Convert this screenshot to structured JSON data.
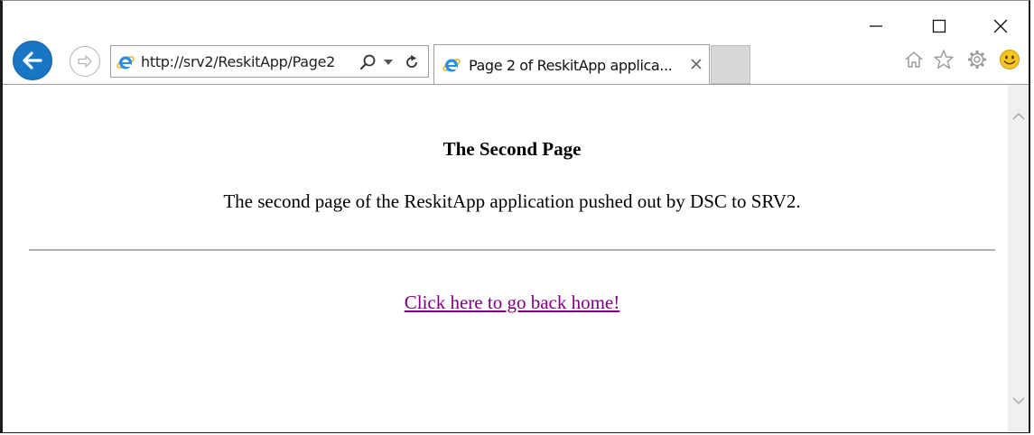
{
  "window": {
    "controls": {
      "minimize_icon": "minimize-icon",
      "maximize_icon": "maximize-icon",
      "close_icon": "close-icon"
    }
  },
  "toolbar": {
    "back_icon": "back-arrow-icon",
    "forward_icon": "forward-arrow-icon",
    "address": {
      "url": "http://srv2/ReskitApp/Page2",
      "icons": [
        "ie-logo-icon",
        "search-icon",
        "dropdown-icon",
        "refresh-icon"
      ]
    },
    "tab": {
      "title": "Page 2 of ReskitApp applica...",
      "close_icon": "close-icon"
    },
    "right_icons": [
      "home-icon",
      "star-icon",
      "gear-icon",
      "smiley-icon"
    ]
  },
  "page": {
    "heading": "The Second Page",
    "body": "The second page of the ReskitApp application pushed out by DSC to SRV2.",
    "link": "Click here to go back home!"
  },
  "colors": {
    "accent_blue": "#1976c5",
    "link_visited": "#800080",
    "new_tab_bg": "#d8d8d8"
  }
}
